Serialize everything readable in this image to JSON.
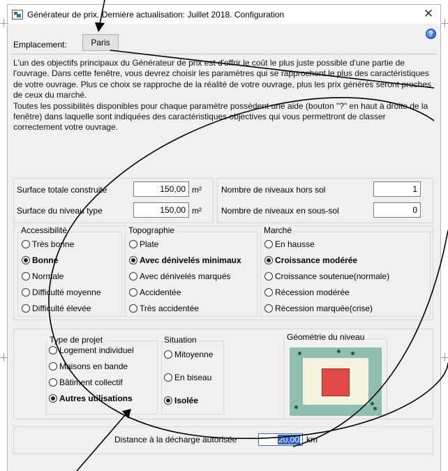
{
  "window": {
    "title": "Générateur de prix. Dernière actualisation: Juillet 2018. Configuration",
    "close_glyph": "✕",
    "help_glyph": "?"
  },
  "location": {
    "label": "Emplacement:",
    "value": "Paris"
  },
  "description": {
    "paragraph1": "L'un des objectifs principaux du Générateur de prix est d'offrir le coût le plus juste possible d'une partie de l'ouvrage. Dans cette fenêtre, vous devrez choisir les paramètres qui se rapprochent le plus des caractéristiques de votre ouvrage. Plus ce choix se rapproche de la réalité de votre ouvrage, plus les prix générés seront proches de ceux du marché.",
    "paragraph2": "Toutes les possibilités disponibles pour chaque paramètre possèdent une aide (bouton \"?\" en haut à droite de la fenêtre) dans laquelle sont indiquées des caractéristiques objectives qui vous permettront de classer correctement votre ouvrage."
  },
  "dimensions": {
    "surface_total_label": "Surface totale construite",
    "surface_total_value": "150,00",
    "surface_type_label": "Surface du niveau type",
    "surface_type_value": "150,00",
    "unit": "m²",
    "levels_above_label": "Nombre de niveaux hors sol",
    "levels_above_value": "1",
    "levels_below_label": "Nombre de niveaux en sous-sol",
    "levels_below_value": "0"
  },
  "accessibilite": {
    "title": "Accessibilité",
    "options": [
      "Très bonne",
      "Bonne",
      "Normale",
      "Difficulté moyenne",
      "Difficulté élevée"
    ],
    "selected": "Bonne"
  },
  "topographie": {
    "title": "Topographie",
    "options": [
      "Plate",
      "Avec dénivelés minimaux",
      "Avec dénivelés marqués",
      "Accidentée",
      "Très accidentée"
    ],
    "selected": "Avec dénivelés minimaux"
  },
  "marche": {
    "title": "Marché",
    "options": [
      "En hausse",
      "Croissance modérée",
      "Croissance soutenue(normale)",
      "Récession modérée",
      "Récession marquée(crise)"
    ],
    "selected": "Croissance modérée"
  },
  "type_projet": {
    "title": "Type de projet",
    "options": [
      "Logement individuel",
      "Maisons en bande",
      "Bâtiment collectif",
      "Autres utilisations"
    ],
    "selected": "Autres utilisations"
  },
  "situation": {
    "title": "Situation",
    "options": [
      "Mitoyenne",
      "En biseau",
      "Isolée"
    ],
    "selected": "Isolée"
  },
  "geometrie": {
    "title": "Géométrie du niveau",
    "colors": {
      "ground": "#8fbdb0",
      "plot": "#f3f3df",
      "building": "#e24a4a"
    }
  },
  "distance": {
    "label": "Distance à la décharge autorisée",
    "value": "20,00",
    "unit": "km"
  }
}
